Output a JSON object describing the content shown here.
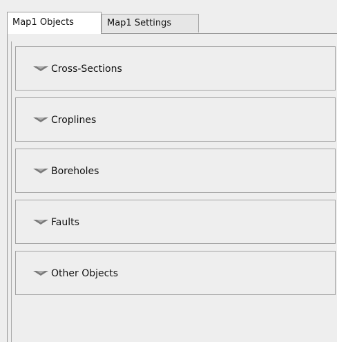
{
  "tabs": [
    {
      "label": "Map1 Objects",
      "active": true
    },
    {
      "label": "Map1 Settings",
      "active": false
    }
  ],
  "sections": [
    {
      "label": "Cross-Sections",
      "icon": "triangle-down-icon"
    },
    {
      "label": "Croplines",
      "icon": "triangle-down-icon"
    },
    {
      "label": "Boreholes",
      "icon": "triangle-down-icon"
    },
    {
      "label": "Faults",
      "icon": "triangle-down-icon"
    },
    {
      "label": "Other Objects",
      "icon": "triangle-down-icon"
    }
  ],
  "colors": {
    "background": "#eeeeee",
    "active_tab": "#ffffff",
    "border": "#a3a3a3",
    "triangle": "#7a7a7a"
  }
}
